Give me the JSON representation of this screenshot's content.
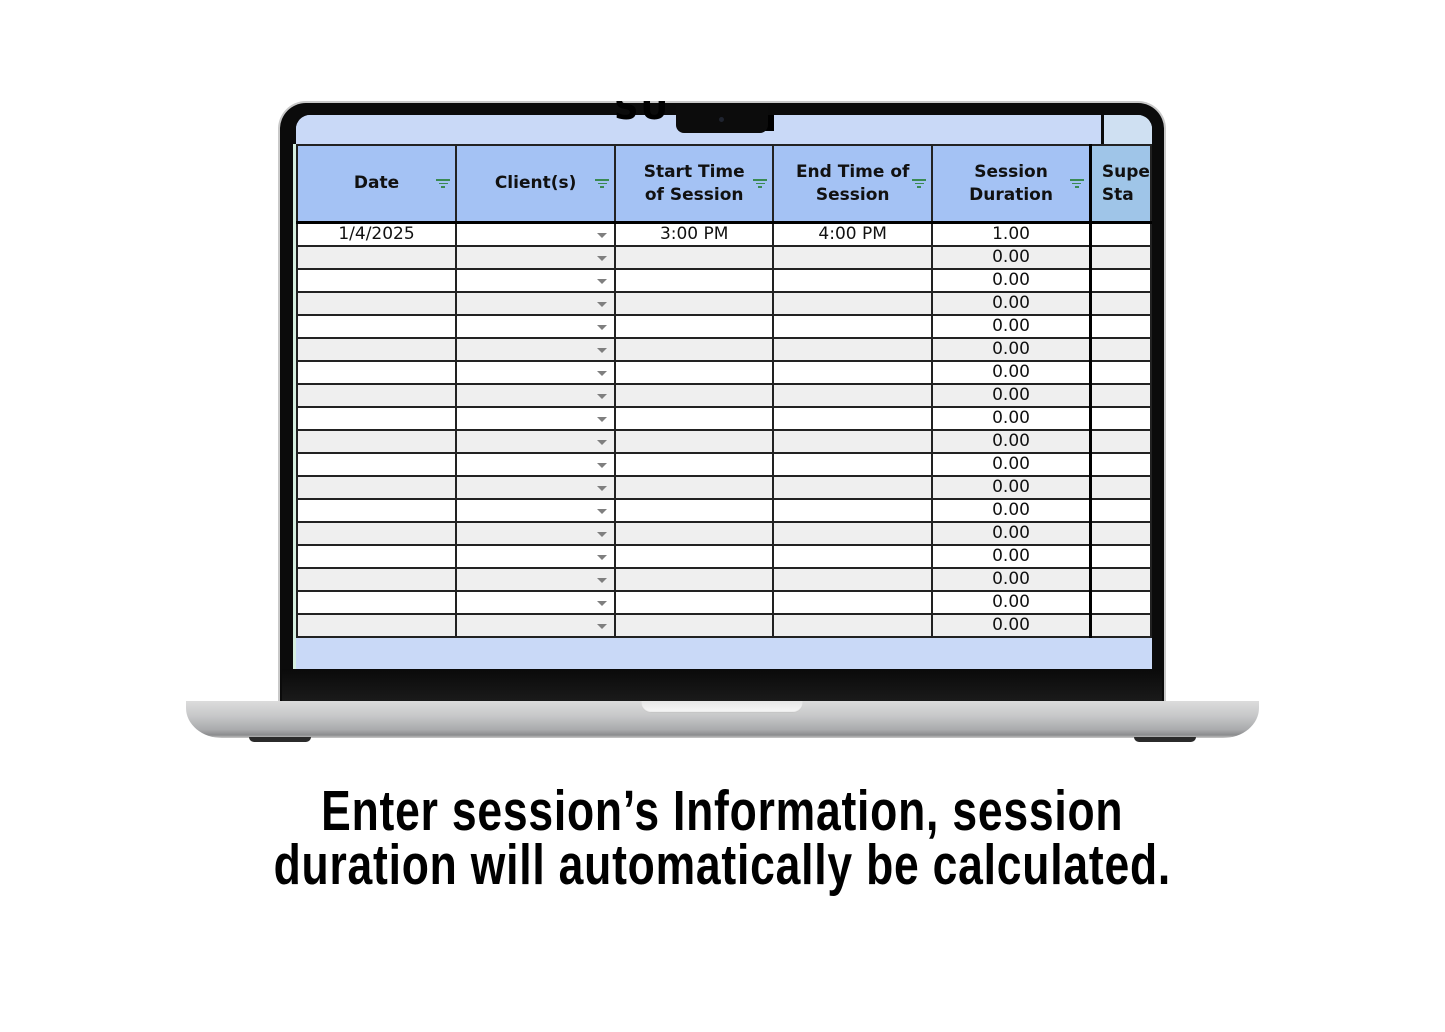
{
  "spreadsheet": {
    "columns": [
      {
        "label": "Date",
        "has_filter": true
      },
      {
        "label": "Client(s)",
        "has_filter": true
      },
      {
        "label": "Start Time of Session",
        "has_filter": true
      },
      {
        "label": "End Time of Session",
        "has_filter": true
      },
      {
        "label": "Session Duration",
        "has_filter": true
      },
      {
        "label": "Supe\nSta",
        "has_filter": false
      }
    ],
    "header_lines": {
      "date": [
        "Date"
      ],
      "clients": [
        "Client(s)"
      ],
      "start": [
        "Start Time",
        "of Session"
      ],
      "end": [
        "End Time of",
        "Session"
      ],
      "duration": [
        "Session",
        "Duration"
      ],
      "sup": [
        "Supe",
        "Sta"
      ]
    },
    "rows": [
      {
        "date": "1/4/2025",
        "client": "",
        "start": "3:00 PM",
        "end": "4:00 PM",
        "duration": "1.00",
        "sup": ""
      },
      {
        "date": "",
        "client": "",
        "start": "",
        "end": "",
        "duration": "0.00",
        "sup": ""
      },
      {
        "date": "",
        "client": "",
        "start": "",
        "end": "",
        "duration": "0.00",
        "sup": ""
      },
      {
        "date": "",
        "client": "",
        "start": "",
        "end": "",
        "duration": "0.00",
        "sup": ""
      },
      {
        "date": "",
        "client": "",
        "start": "",
        "end": "",
        "duration": "0.00",
        "sup": ""
      },
      {
        "date": "",
        "client": "",
        "start": "",
        "end": "",
        "duration": "0.00",
        "sup": ""
      },
      {
        "date": "",
        "client": "",
        "start": "",
        "end": "",
        "duration": "0.00",
        "sup": ""
      },
      {
        "date": "",
        "client": "",
        "start": "",
        "end": "",
        "duration": "0.00",
        "sup": ""
      },
      {
        "date": "",
        "client": "",
        "start": "",
        "end": "",
        "duration": "0.00",
        "sup": ""
      },
      {
        "date": "",
        "client": "",
        "start": "",
        "end": "",
        "duration": "0.00",
        "sup": ""
      },
      {
        "date": "",
        "client": "",
        "start": "",
        "end": "",
        "duration": "0.00",
        "sup": ""
      },
      {
        "date": "",
        "client": "",
        "start": "",
        "end": "",
        "duration": "0.00",
        "sup": ""
      },
      {
        "date": "",
        "client": "",
        "start": "",
        "end": "",
        "duration": "0.00",
        "sup": ""
      },
      {
        "date": "",
        "client": "",
        "start": "",
        "end": "",
        "duration": "0.00",
        "sup": ""
      },
      {
        "date": "",
        "client": "",
        "start": "",
        "end": "",
        "duration": "0.00",
        "sup": ""
      },
      {
        "date": "",
        "client": "",
        "start": "",
        "end": "",
        "duration": "0.00",
        "sup": ""
      },
      {
        "date": "",
        "client": "",
        "start": "",
        "end": "",
        "duration": "0.00",
        "sup": ""
      },
      {
        "date": "",
        "client": "",
        "start": "",
        "end": "",
        "duration": "0.00",
        "sup": ""
      }
    ],
    "colors": {
      "header_bg": "#a4c2f4",
      "header_sup_bg": "#9fc5e8",
      "title_band_bg": "#c9d9f7",
      "row_alt_bg": "#efefef",
      "filter_icon": "#3a8a52"
    }
  },
  "caption": {
    "line1": "Enter session’s Information, session",
    "line2": "duration will automatically be calculated."
  }
}
